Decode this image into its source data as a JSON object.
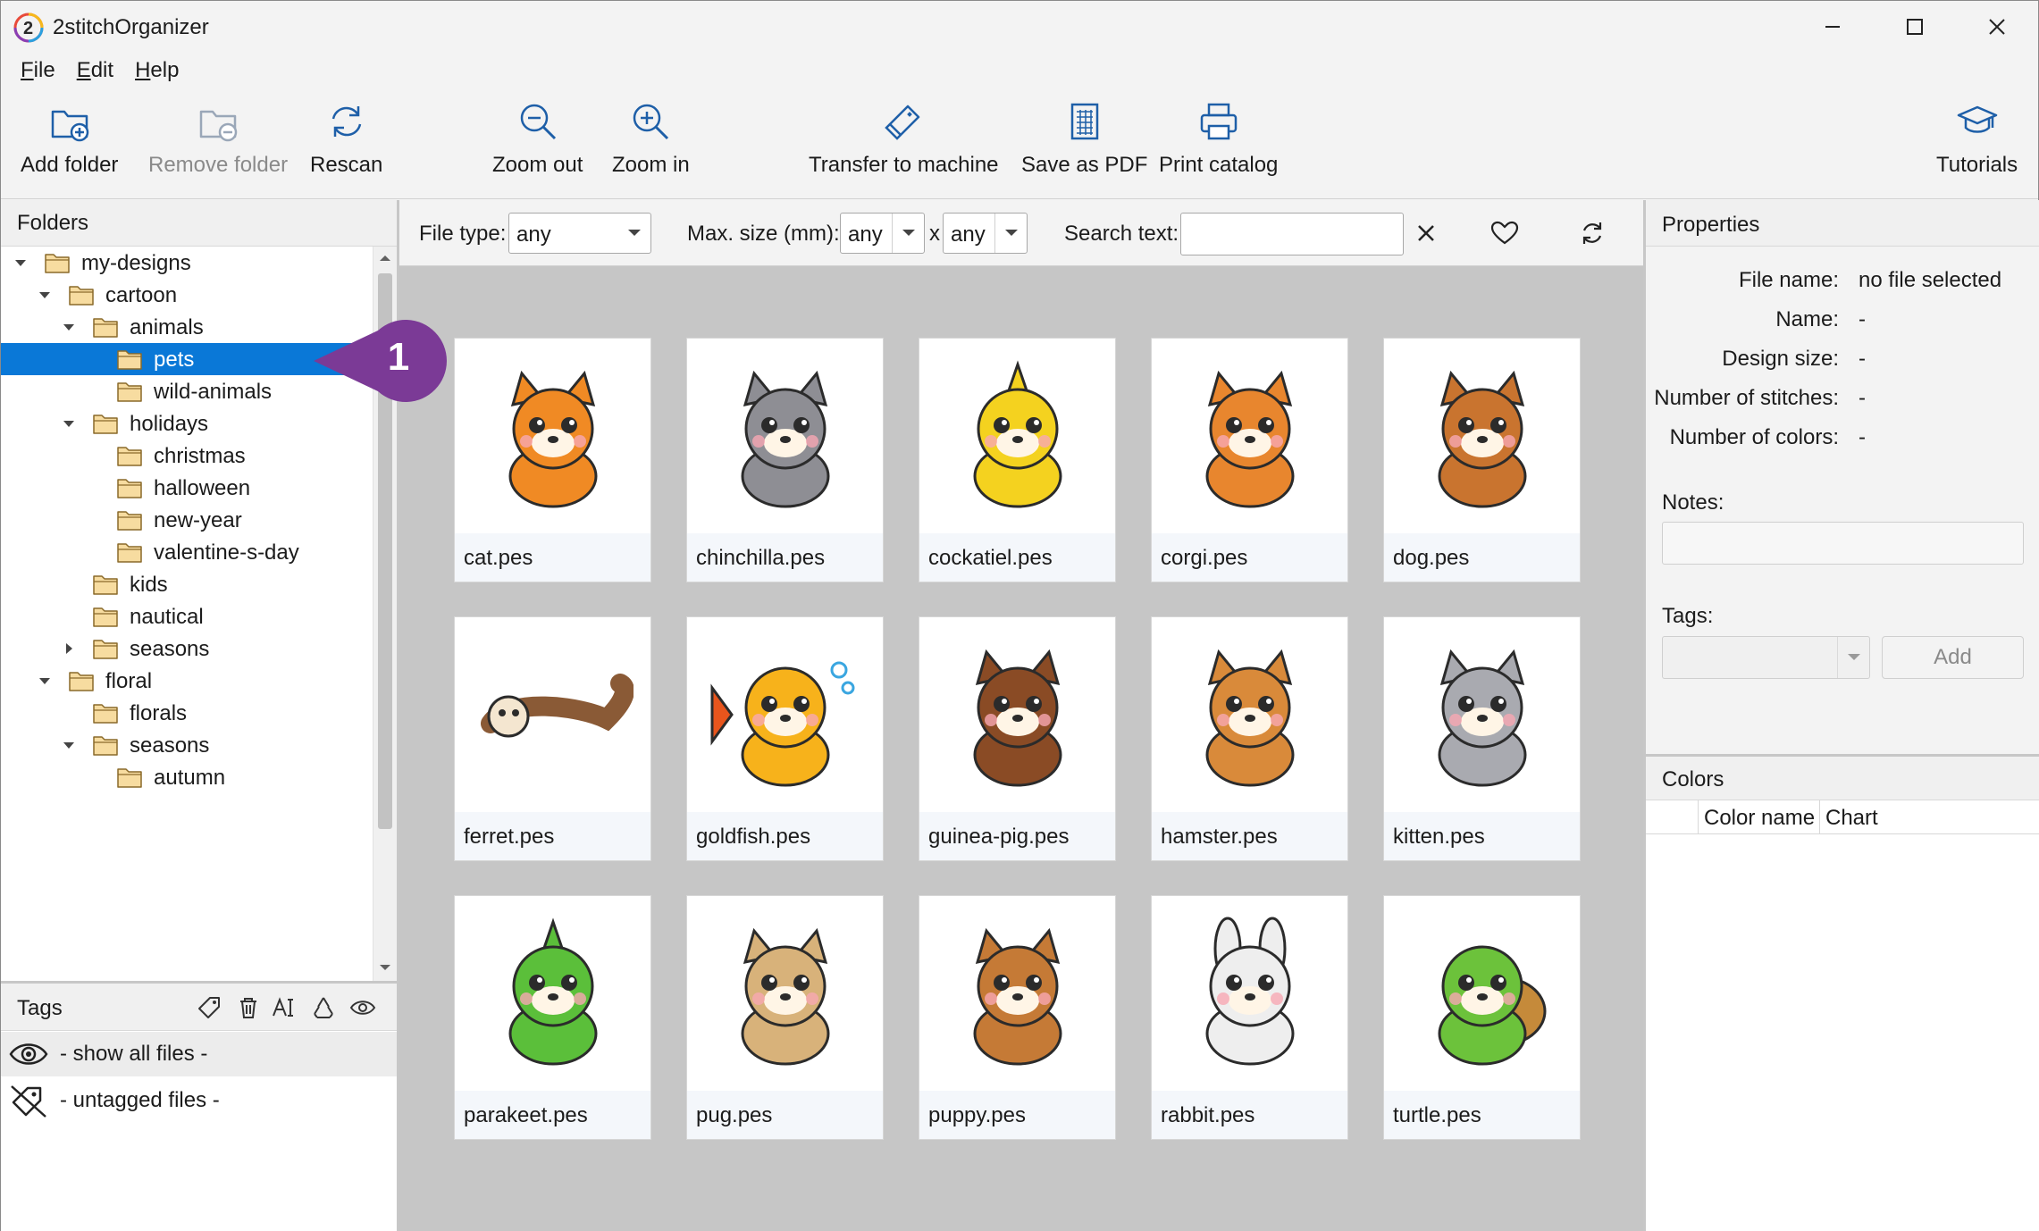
{
  "window": {
    "title": "2stitchOrganizer",
    "logo_text": "2",
    "controls": [
      "minimize",
      "maximize",
      "close"
    ]
  },
  "menu": [
    {
      "label": "File",
      "accel": "F",
      "rest": "ile"
    },
    {
      "label": "Edit",
      "accel": "E",
      "rest": "dit"
    },
    {
      "label": "Help",
      "accel": "H",
      "rest": "elp"
    }
  ],
  "toolbar": {
    "add_folder": "Add folder",
    "remove_folder": "Remove folder",
    "rescan": "Rescan",
    "zoom_out": "Zoom out",
    "zoom_in": "Zoom in",
    "transfer": "Transfer to machine",
    "save_pdf": "Save as PDF",
    "print_catalog": "Print catalog",
    "tutorials": "Tutorials"
  },
  "folders": {
    "header": "Folders",
    "tree": [
      {
        "label": "my-designs",
        "level": 0,
        "arrow": "down"
      },
      {
        "label": "cartoon",
        "level": 1,
        "arrow": "down"
      },
      {
        "label": "animals",
        "level": 2,
        "arrow": "down"
      },
      {
        "label": "pets",
        "level": 3,
        "arrow": "",
        "selected": true
      },
      {
        "label": "wild-animals",
        "level": 3,
        "arrow": ""
      },
      {
        "label": "holidays",
        "level": 2,
        "arrow": "down"
      },
      {
        "label": "christmas",
        "level": 3,
        "arrow": ""
      },
      {
        "label": "halloween",
        "level": 3,
        "arrow": ""
      },
      {
        "label": "new-year",
        "level": 3,
        "arrow": ""
      },
      {
        "label": "valentine-s-day",
        "level": 3,
        "arrow": ""
      },
      {
        "label": "kids",
        "level": 2,
        "arrow": ""
      },
      {
        "label": "nautical",
        "level": 2,
        "arrow": ""
      },
      {
        "label": "seasons",
        "level": 2,
        "arrow": "right"
      },
      {
        "label": "floral",
        "level": 1,
        "arrow": "down"
      },
      {
        "label": "florals",
        "level": 2,
        "arrow": ""
      },
      {
        "label": "seasons",
        "level": 2,
        "arrow": "down"
      },
      {
        "label": "autumn",
        "level": 3,
        "arrow": ""
      }
    ]
  },
  "tags": {
    "header": "Tags",
    "tools": [
      "tag-icon",
      "trash-icon",
      "rename-icon",
      "recycle-icon",
      "eye-icon"
    ],
    "items": [
      {
        "label": "- show all files -",
        "icon": "eye-icon"
      },
      {
        "label": "- untagged files -",
        "icon": "no-tag-icon"
      }
    ]
  },
  "filter": {
    "file_type_label": "File type:",
    "file_type_value": "any",
    "max_size_label": "Max. size (mm):",
    "max_w": "any",
    "times": "x",
    "max_h": "any",
    "search_label": "Search text:",
    "search_value": ""
  },
  "files": [
    {
      "name": "cat.pes",
      "animal": "cat",
      "color": "#f08a24"
    },
    {
      "name": "chinchilla.pes",
      "animal": "chinchilla",
      "color": "#8e8e94"
    },
    {
      "name": "cockatiel.pes",
      "animal": "cockatiel",
      "color": "#f4d21f"
    },
    {
      "name": "corgi.pes",
      "animal": "corgi",
      "color": "#e8862e"
    },
    {
      "name": "dog.pes",
      "animal": "dog",
      "color": "#c9742f"
    },
    {
      "name": "ferret.pes",
      "animal": "ferret",
      "color": "#8a5a36"
    },
    {
      "name": "goldfish.pes",
      "animal": "goldfish",
      "color": "#f7b21b"
    },
    {
      "name": "guinea-pig.pes",
      "animal": "guinea-pig",
      "color": "#8a4b25"
    },
    {
      "name": "hamster.pes",
      "animal": "hamster",
      "color": "#d98a3a"
    },
    {
      "name": "kitten.pes",
      "animal": "kitten",
      "color": "#a9aab0"
    },
    {
      "name": "parakeet.pes",
      "animal": "parakeet",
      "color": "#5bbf3a"
    },
    {
      "name": "pug.pes",
      "animal": "pug",
      "color": "#d8b27a"
    },
    {
      "name": "puppy.pes",
      "animal": "puppy",
      "color": "#c57a36"
    },
    {
      "name": "rabbit.pes",
      "animal": "rabbit",
      "color": "#eeeeee"
    },
    {
      "name": "turtle.pes",
      "animal": "turtle",
      "color": "#6cc23b"
    }
  ],
  "properties": {
    "header": "Properties",
    "rows": [
      {
        "key": "File name:",
        "value": "no file selected"
      },
      {
        "key": "Name:",
        "value": "-"
      },
      {
        "key": "Design size:",
        "value": "-"
      },
      {
        "key": "Number of stitches:",
        "value": "-"
      },
      {
        "key": "Number of colors:",
        "value": "-"
      }
    ],
    "notes_label": "Notes:",
    "tags_label": "Tags:",
    "add_button": "Add"
  },
  "colors": {
    "header": "Colors",
    "columns": [
      "",
      "Color name",
      "Chart"
    ]
  },
  "callout": {
    "number": "1",
    "color": "#7b3a96"
  },
  "accent": "#0a78d7"
}
